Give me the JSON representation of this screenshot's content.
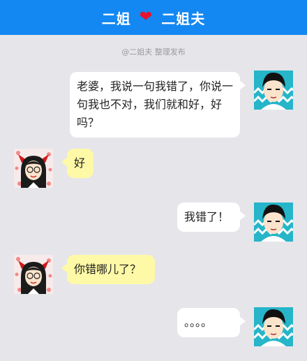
{
  "header": {
    "left_name": "二姐",
    "right_name": "二姐夫",
    "heart_icon": "heart-icon",
    "background": "#1488f2"
  },
  "credit": "@二姐夫 整理发布",
  "messages": [
    {
      "sender": "husband",
      "text": "老婆，我说一句我错了，你说一句我也不对，我们就和好，好吗？"
    },
    {
      "sender": "wife",
      "text": "好"
    },
    {
      "sender": "husband",
      "text": "我错了！"
    },
    {
      "sender": "wife",
      "text": "你错哪儿了？"
    },
    {
      "sender": "husband",
      "text": "。。。。"
    }
  ],
  "colors": {
    "husband_bubble": "#ffffff",
    "wife_bubble": "#fef9a6",
    "background": "#e6e5ea"
  }
}
